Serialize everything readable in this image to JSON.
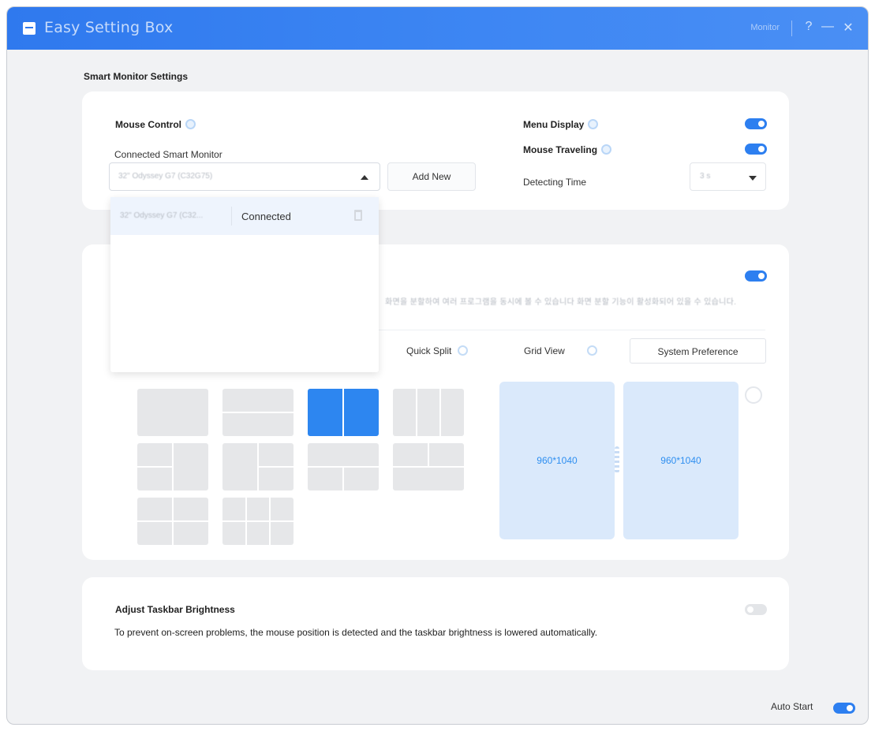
{
  "titlebar": {
    "title": "Easy Setting Box",
    "user_label": "Monitor",
    "help": "?",
    "minimize": "—",
    "close": "✕",
    "accent_color": "#2f79ee"
  },
  "section_title": "Smart Monitor Settings",
  "mouse_control": {
    "title": "Mouse Control",
    "connected_label": "Connected Smart Monitor",
    "selected_monitor": "32\" Odyssey G7 (C32G75)",
    "add_new_label": "Add New",
    "dropdown": {
      "items": [
        {
          "name": "32\" Odyssey G7 (C32...",
          "status": "Connected"
        }
      ]
    },
    "menu_display": {
      "label": "Menu Display",
      "on": true
    },
    "mouse_traveling": {
      "label": "Mouse Traveling",
      "on": true
    },
    "detecting_time": {
      "label": "Detecting Time",
      "value": "3 s"
    }
  },
  "split_screen": {
    "toggle_on": true,
    "description": "화면을 분할하여 여러 프로그램을 동시에 볼 수 있습니다 화면 분할 기능이 활성화되어 있을 수 있습니다.",
    "tabs": [
      {
        "label": "Quick Split",
        "icon": "info-icon"
      },
      {
        "label": "Grid View",
        "icon": "info-icon"
      },
      {
        "label": "System Preference"
      }
    ],
    "preview": {
      "panes": [
        "960*1040",
        "960*1040"
      ]
    }
  },
  "taskbar": {
    "title": "Adjust Taskbar Brightness",
    "description": "To prevent on-screen problems, the mouse position is detected and the taskbar brightness is lowered automatically.",
    "on": false
  },
  "footer": {
    "auto_start_label": "Auto Start",
    "auto_start_on": true
  }
}
